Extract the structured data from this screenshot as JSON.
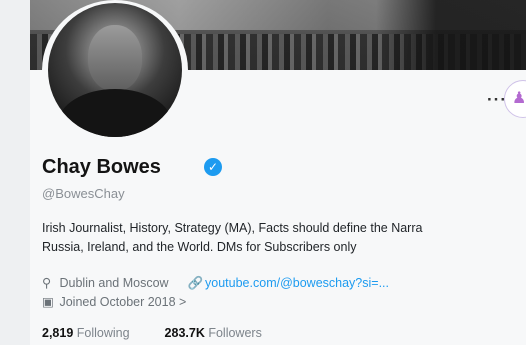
{
  "profile": {
    "name": "Chay Bowes",
    "handle": "@BowesChay",
    "bio_line1": "Irish Journalist, History, Strategy (MA), Facts should define the Narra",
    "bio_line2": "Russia, Ireland, and the World. DMs for Subscribers only",
    "location": "Dublin and Moscow",
    "website": "youtube.com/@boweschay?si=...",
    "joined": "Joined October 2018 >",
    "following_count": "2,819",
    "following_label": "Following",
    "followers_count": "283.7K",
    "followers_label": "Followers",
    "more_label": "···"
  },
  "icons": {
    "location": "map-pin-icon",
    "link": "link-icon",
    "calendar": "calendar-icon",
    "verified": "verified-badge-icon",
    "person": "person-icon"
  },
  "colors": {
    "accent": "#1d9bf0",
    "muted": "#6b7278"
  }
}
